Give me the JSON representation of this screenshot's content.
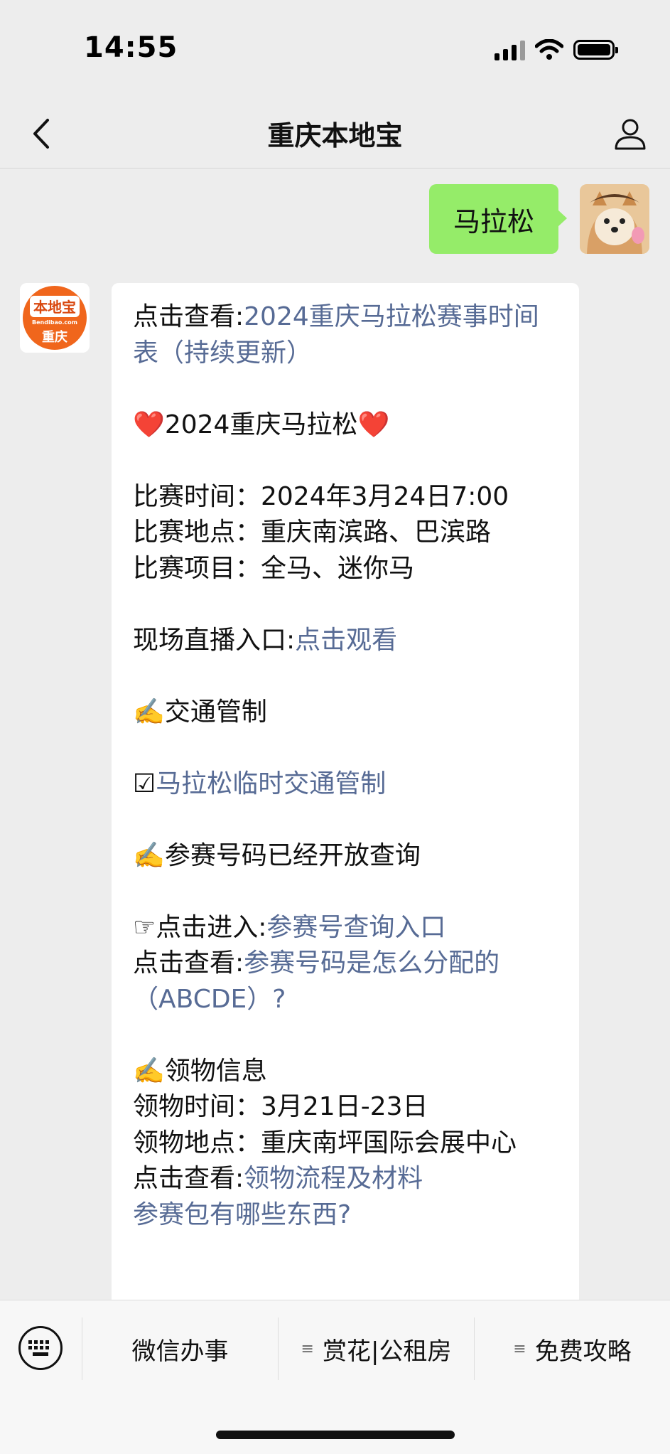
{
  "status_bar": {
    "time": "14:55"
  },
  "nav": {
    "title": "重庆本地宝"
  },
  "sent_message": {
    "text": "马拉松"
  },
  "bot_avatar": {
    "brand_text": "本地宝",
    "domain_text": "Bendibao.com",
    "city_text": "重庆",
    "accent": "#f0661c"
  },
  "received_message": {
    "l1_prefix": "点击查看:",
    "l1_link": "2024重庆马拉松赛事时间表（持续更新）",
    "heading_left": "❤️",
    "heading_text": "2024重庆马拉松",
    "heading_right": "❤️",
    "race_time": "比赛时间：2024年3月24日7:00",
    "race_place": "比赛地点：重庆南滨路、巴滨路",
    "race_items": "比赛项目：全马、迷你马",
    "live_prefix": "现场直播入口:",
    "live_link": "点击观看",
    "traffic_emoji": "✍️",
    "traffic_heading": "交通管制",
    "traffic_check": "☑",
    "traffic_link": "马拉松临时交通管制",
    "bib_emoji": "✍️",
    "bib_heading": "参赛号码已经开放查询",
    "bib_pointer": "☞",
    "bib_entry_prefix": "点击进入:",
    "bib_entry_link": "参赛号查询入口",
    "bib_alloc_prefix": "点击查看:",
    "bib_alloc_link": "参赛号码是怎么分配的（ABCDE）?",
    "pickup_emoji": "✍️",
    "pickup_heading": "领物信息",
    "pickup_time": "领物时间：3月21日-23日",
    "pickup_place": "领物地点：重庆南坪国际会展中心",
    "pickup_flow_prefix": "点击查看:",
    "pickup_flow_link": "领物流程及材料",
    "pack_link": "参赛包有哪些东西?"
  },
  "bottom_menu": {
    "items": [
      {
        "label": "微信办事",
        "has_submenu_glyph": false,
        "glyph": ""
      },
      {
        "label": "赏花|公租房",
        "has_submenu_glyph": true,
        "glyph": "≡"
      },
      {
        "label": "免费攻略",
        "has_submenu_glyph": true,
        "glyph": "≡"
      }
    ]
  },
  "colors": {
    "link": "#576b95",
    "sent_bubble": "#95ec69",
    "background": "#ededed"
  }
}
